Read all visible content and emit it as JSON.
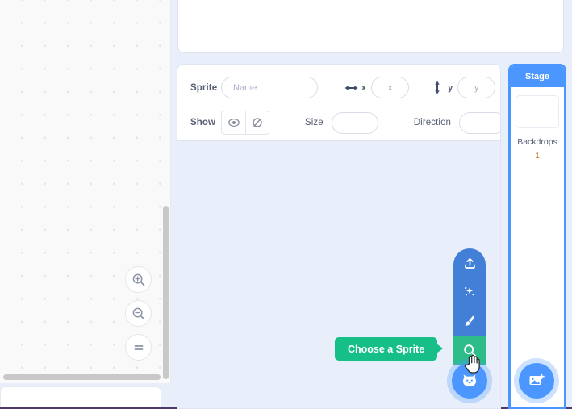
{
  "workspace": {
    "zoom_in_label": "zoom-in",
    "zoom_out_label": "zoom-out",
    "zoom_reset_label": "zoom-reset"
  },
  "sprite_info": {
    "sprite_label": "Sprite",
    "name_placeholder": "Name",
    "name_value": "",
    "x_label": "x",
    "x_placeholder": "x",
    "x_value": "",
    "y_label": "y",
    "y_placeholder": "y",
    "y_value": "",
    "show_label": "Show",
    "size_label": "Size",
    "size_value": "",
    "direction_label": "Direction",
    "direction_value": "",
    "show_icon": "eye-icon",
    "hide_icon": "eye-slash-icon"
  },
  "stage_panel": {
    "header": "Stage",
    "backdrops_label": "Backdrops",
    "backdrops_count": "1",
    "add_backdrop_icon": "image-add-icon"
  },
  "sprite_menu": {
    "items": [
      {
        "icon": "upload-icon",
        "label": "Upload Sprite",
        "active": false
      },
      {
        "icon": "sparkles-icon",
        "label": "Surprise",
        "active": false
      },
      {
        "icon": "paintbrush-icon",
        "label": "Paint",
        "active": false
      },
      {
        "icon": "search-icon",
        "label": "Choose a Sprite",
        "active": true
      }
    ],
    "fab_icon": "cat-icon"
  },
  "tooltip": {
    "text": "Choose a Sprite"
  },
  "colors": {
    "accent_blue": "#4c97ff",
    "menu_blue": "#4280d7",
    "active_green": "#2dbd8a",
    "tooltip_green": "#15bf87",
    "panel_bg": "#e9effa",
    "text": "#575e75"
  }
}
